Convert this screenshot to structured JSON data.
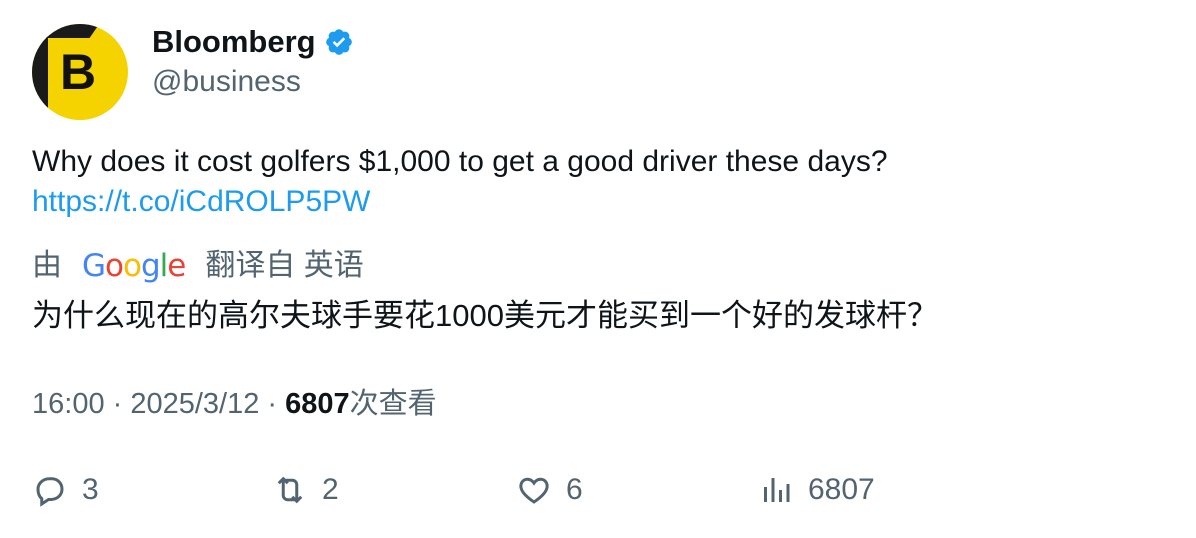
{
  "author": {
    "display_name": "Bloomberg",
    "handle": "@business",
    "avatar_letter": "B",
    "verified_color": "#1d9bf0"
  },
  "tweet": {
    "text": "Why does it cost golfers $1,000 to get a good driver these days?",
    "link": "https://t.co/iCdROLP5PW"
  },
  "translation": {
    "prefix": "由",
    "provider_letters": [
      "G",
      "o",
      "o",
      "g",
      "l",
      "e"
    ],
    "suffix": "翻译自 英语",
    "text": "为什么现在的高尔夫球手要花1000美元才能买到一个好的发球杆？"
  },
  "meta": {
    "time_date": "16:00 · 2025/3/12 · ",
    "views_count": "6807",
    "views_label": "次查看"
  },
  "actions": {
    "reply_count": "3",
    "retweet_count": "2",
    "like_count": "6",
    "views_count": "6807"
  }
}
